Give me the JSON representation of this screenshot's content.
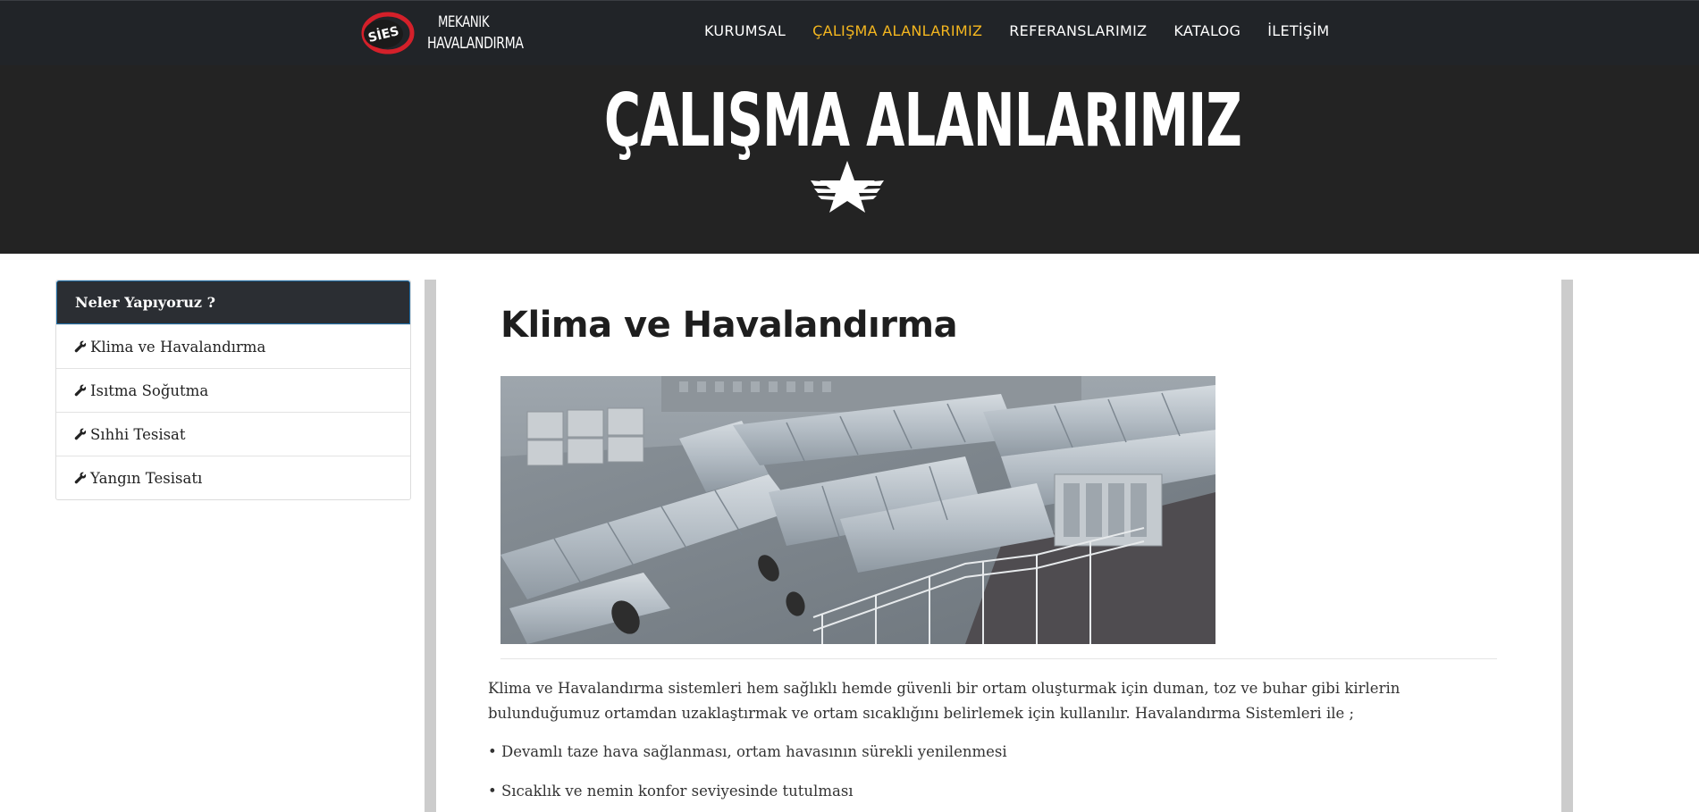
{
  "brand": {
    "line1": "MEKANIK",
    "line2": "HAVALANDIRMA",
    "logo_text": "SİES"
  },
  "nav": {
    "items": [
      {
        "label": "KURUMSAL",
        "active": false
      },
      {
        "label": "ÇALIŞMA ALANLARIMIZ",
        "active": true
      },
      {
        "label": "REFERANSLARIMIZ",
        "active": false
      },
      {
        "label": "KATALOG",
        "active": false
      },
      {
        "label": "İLETİŞİM",
        "active": false
      }
    ]
  },
  "hero": {
    "title": "ÇALIŞMA ALANLARIMIZ",
    "icon": "winged-star-icon"
  },
  "sidebar": {
    "heading": "Neler Yapıyoruz ?",
    "items": [
      {
        "label": "Klima ve Havalandırma",
        "icon": "wrench-icon"
      },
      {
        "label": "Isıtma Soğutma",
        "icon": "wrench-icon"
      },
      {
        "label": "Sıhhi Tesisat",
        "icon": "wrench-icon"
      },
      {
        "label": "Yangın Tesisatı",
        "icon": "wrench-icon"
      }
    ]
  },
  "content": {
    "title": "Klima ve Havalandırma",
    "image_subject": "rooftop-hvac-ductwork-photo",
    "paragraph": "Klima ve Havalandırma sistemleri hem sağlıklı hemde güvenli bir ortam oluşturmak için duman, toz ve buhar gibi kirlerin bulunduğumuz ortamdan uzaklaştırmak ve ortam sıcaklığını belirlemek için kullanılır. Havalandırma Sistemleri ile ;",
    "bullets": [
      "• Devamlı taze hava sağlanması, ortam havasının sürekli yenilenmesi",
      "• Sıcaklık ve nemin konfor seviyesinde tutulması"
    ]
  },
  "colors": {
    "nav_bg": "#212428",
    "hero_bg": "#232323",
    "accent": "#f5b71f",
    "logo_red": "#d4202a"
  }
}
